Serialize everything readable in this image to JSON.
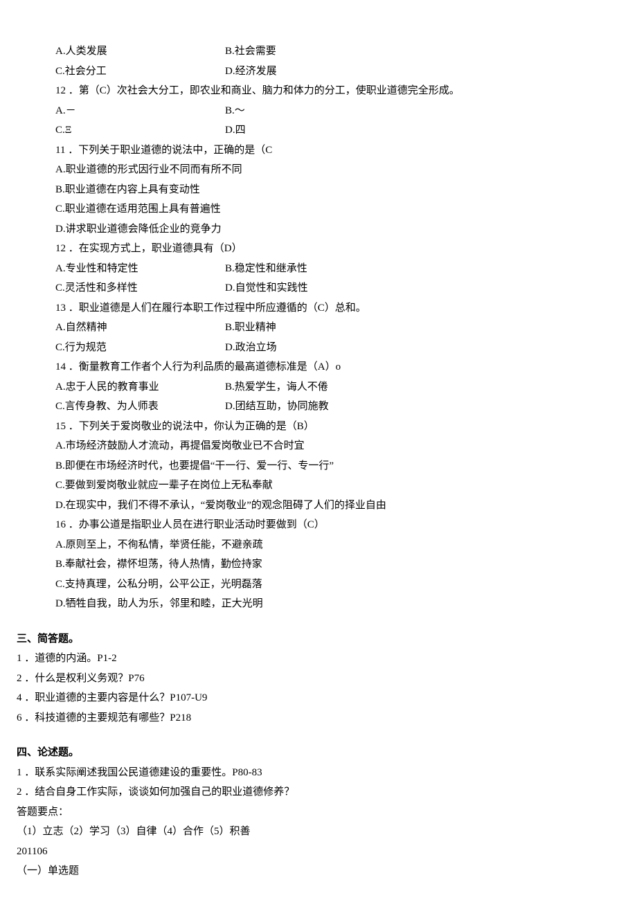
{
  "q_preamble": {
    "optA": "A.人类发展",
    "optB": "B.社会需要",
    "optC": "C.社会分工",
    "optD": "D.经济发展"
  },
  "q12a": {
    "stem": "12 ．第（C）次社会大分工，即农业和商业、脑力和体力的分工，使职业道德完全形成。",
    "optA": "A.－",
    "optB": "B.～",
    "optC": "C.Ξ",
    "optD": "D.四"
  },
  "q11": {
    "stem": "11 ．下列关于职业道德的说法中，正确的是（C",
    "optA": "A.职业道德的形式因行业不同而有所不同",
    "optB": "B.职业道德在内容上具有变动性",
    "optC": "C.职业道德在适用范围上具有普遍性",
    "optD": "D.讲求职业道德会降低企业的竞争力"
  },
  "q12b": {
    "stem": "12 ．在实现方式上，职业道德具有（D）",
    "optA": "A.专业性和特定性",
    "optB": "B.稳定性和继承性",
    "optC": "C.灵活性和多样性",
    "optD": "D.自觉性和实践性"
  },
  "q13": {
    "stem": "13 ．职业道德是人们在履行本职工作过程中所应遵循的（C）总和。",
    "optA": "A.自然精神",
    "optB": "B.职业精神",
    "optC": "C.行为规范",
    "optD": "D.政治立场"
  },
  "q14": {
    "stem": "14 ．衡量教育工作者个人行为利品质的最高道德标准是（A）o",
    "optA": "A.忠于人民的教育事业",
    "optB": "B.热爱学生，诲人不倦",
    "optC": "C.言传身教、为人师表",
    "optD": "D.团结互助，协同施教"
  },
  "q15": {
    "stem": "15 ．下列关于爱岗敬业的说法中，你认为正确的是（B）",
    "optA": "A.市场经济鼓励人才流动，再提倡爱岗敬业已不合时宜",
    "optB": "B.即便在市场经济时代，也要提倡“干一行、爱一行、专一行”",
    "optC": "C.要做到爱岗敬业就应一辈子在岗位上无私奉献",
    "optD": "D.在现实中，我们不得不承认，“爱岗敬业”的观念阻碍了人们的择业自由"
  },
  "q16": {
    "stem": "16 ．办事公道是指职业人员在进行职业活动时要做到（C）",
    "optA": "A.原则至上，不徇私情，举贤任能，不避亲疏",
    "optB": "B.奉献社会，襟怀坦荡，待人热情，勤俭持家",
    "optC": "C.支持真理，公私分明，公平公正，光明磊落",
    "optD": "D.牺牲自我，助人为乐，邻里和睦，正大光明"
  },
  "section3": {
    "title": "三、简答题。",
    "items": {
      "i1": "1 ．道德的内涵。P1-2",
      "i2": "2 ．什么是权利义务观？P76",
      "i4": "4 ．职业道德的主要内容是什么？P107-U9",
      "i6": "6 ．科技道德的主要规范有哪些？P218"
    }
  },
  "section4": {
    "title": "四、论述题。",
    "items": {
      "i1": "1 ．联系实际阐述我国公民道德建设的重要性。P80-83",
      "i2": "2 ．结合自身工作实际，谈谈如何加强自己的职业道德修养？"
    },
    "answer_label": "答题要点：",
    "answer_points": "（1）立志（2）学习（3）自律（4）合作（5）积善",
    "code": "201106",
    "subheading": "（一）单选题"
  }
}
